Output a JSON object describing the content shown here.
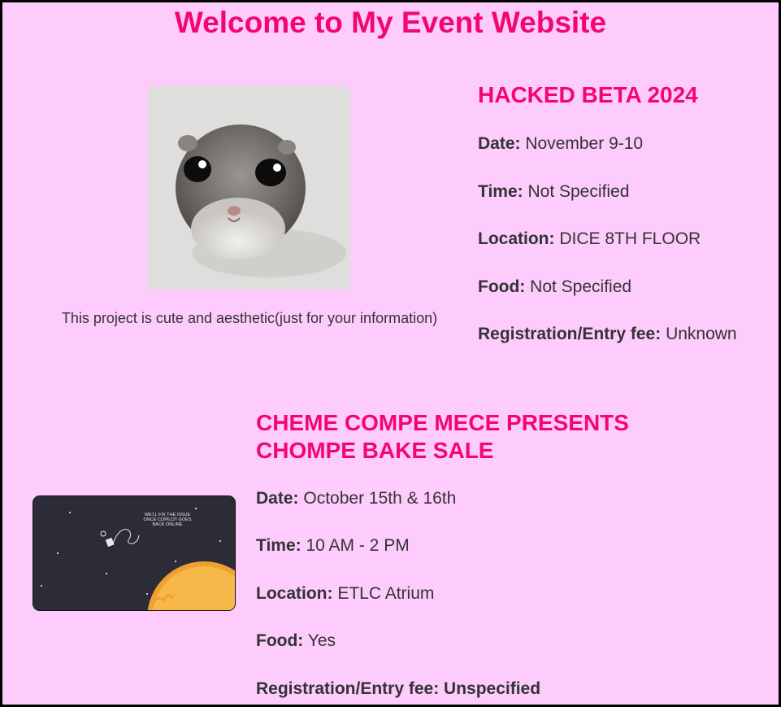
{
  "page": {
    "title": "Welcome to My Event Website"
  },
  "events": [
    {
      "title": "HACKED BETA 2024",
      "caption": "This project is cute and aesthetic(just for your information)",
      "details": [
        {
          "label": "Date:",
          "value": "November 9-10"
        },
        {
          "label": "Time:",
          "value": "Not Specified"
        },
        {
          "label": "Location:",
          "value": "DICE 8TH FLOOR"
        },
        {
          "label": "Food:",
          "value": "Not Specified"
        },
        {
          "label": "Registration/Entry fee:",
          "value": "Unknown"
        }
      ]
    },
    {
      "title_line1": "CHEME COMPE MECE PRESENTS",
      "title_line2": "CHOMPE BAKE SALE",
      "image_text_1": "WE'LL FIX THE ISSUE",
      "image_text_2": "ONCE COPILOT GOES",
      "image_text_3": "BACK ONLINE",
      "details": [
        {
          "label": "Date:",
          "value": "October 15th & 16th"
        },
        {
          "label": "Time:",
          "value": "10 AM - 2 PM"
        },
        {
          "label": "Location:",
          "value": "ETLC Atrium"
        },
        {
          "label": "Food:",
          "value": "Yes"
        },
        {
          "label": "Registration/Entry fee: Unspecified",
          "value": ""
        }
      ]
    }
  ],
  "colors": {
    "background": "#fecbfd",
    "accent": "#f3076e",
    "text": "#333333"
  }
}
